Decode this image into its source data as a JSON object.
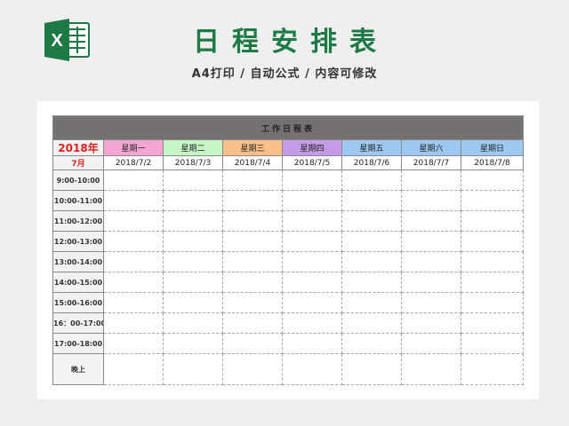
{
  "header": {
    "title": "日程安排表",
    "subtitle": "A4打印 / 自动公式 / 内容可修改",
    "logo_letter": "X",
    "logo_color": "#1d7a45"
  },
  "table": {
    "title": "工作日程表",
    "year": "2018年",
    "month": "7月",
    "days": [
      {
        "label": "星期一",
        "color": "#f4a6d2"
      },
      {
        "label": "星期二",
        "color": "#c6f5c6"
      },
      {
        "label": "星期三",
        "color": "#f9c08a"
      },
      {
        "label": "星期四",
        "color": "#c49be6"
      },
      {
        "label": "星期五",
        "color": "#9cc8f2"
      },
      {
        "label": "星期六",
        "color": "#9cc8f2"
      },
      {
        "label": "星期日",
        "color": "#9cc8f2"
      }
    ],
    "dates": [
      "2018/7/2",
      "2018/7/3",
      "2018/7/4",
      "2018/7/5",
      "2018/7/6",
      "2018/7/7",
      "2018/7/8"
    ],
    "times": [
      "9:00-10:00",
      "10:00-11:00",
      "11:00-12:00",
      "12:00-13:00",
      "13:00-14:00",
      "14:00-15:00",
      "15:00-16:00",
      "16：00-17:00",
      "17:00-18:00",
      "晚上"
    ]
  }
}
